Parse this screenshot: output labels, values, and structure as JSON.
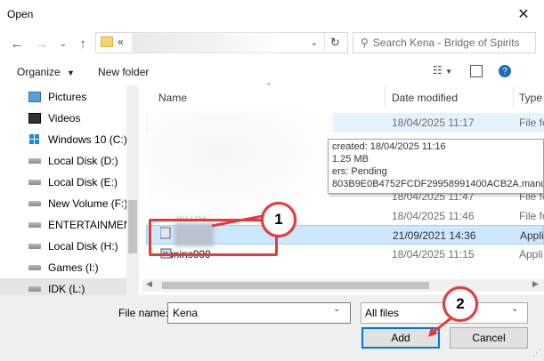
{
  "window": {
    "title": "Open"
  },
  "address": {
    "chevron": "«",
    "search_placeholder": "Search Kena - Bridge of Spirits"
  },
  "toolbar": {
    "organize": "Organize",
    "new_folder": "New folder"
  },
  "sidebar": {
    "items": [
      {
        "label": "Pictures",
        "icon": "pictures-icon"
      },
      {
        "label": "Videos",
        "icon": "videos-icon"
      },
      {
        "label": "Windows 10 (C:)",
        "icon": "windows-drive-icon"
      },
      {
        "label": "Local Disk (D:)",
        "icon": "drive-icon"
      },
      {
        "label": "Local Disk (E:)",
        "icon": "drive-icon"
      },
      {
        "label": "New Volume (F:)",
        "icon": "drive-icon"
      },
      {
        "label": "ENTERTAINMENT",
        "icon": "drive-icon"
      },
      {
        "label": "Local Disk (H:)",
        "icon": "drive-icon"
      },
      {
        "label": "Games (I:)",
        "icon": "drive-icon"
      },
      {
        "label": "IDK (L:)",
        "icon": "drive-icon"
      }
    ]
  },
  "columns": {
    "name": "Name",
    "date": "Date modified",
    "type": "Type"
  },
  "rows": [
    {
      "name": "",
      "date": "18/04/2025 11:17",
      "type": "File fo"
    },
    {
      "name": "",
      "date": "18/04/2025 11:47",
      "type": "File fo"
    },
    {
      "name": "",
      "date": "18/04/2025 11:46",
      "type": "File fo"
    },
    {
      "name": "",
      "date": "21/09/2021 14:36",
      "type": "Appli"
    },
    {
      "name": "unins000",
      "date": "18/04/2025 11:15",
      "type": "Appli"
    }
  ],
  "tooltip": {
    "line1": "created: 18/04/2025 11:16",
    "line2": "1.25 MB",
    "line3": "ers: Pending",
    "line4": "803B9E0B4752FCDF29958991400ACB2A.manc"
  },
  "partial_name_2": "MIYAV",
  "bottom": {
    "file_name_label": "File name:",
    "file_name_value": "Kena",
    "file_type": "All files",
    "add_label": "Add",
    "cancel_label": "Cancel"
  },
  "callouts": {
    "one": "1",
    "two": "2"
  },
  "colors": {
    "callout": "#e23b3b",
    "selection": "#cce8ff",
    "highlight": "#e5f3ff",
    "accent": "#0078d7"
  }
}
